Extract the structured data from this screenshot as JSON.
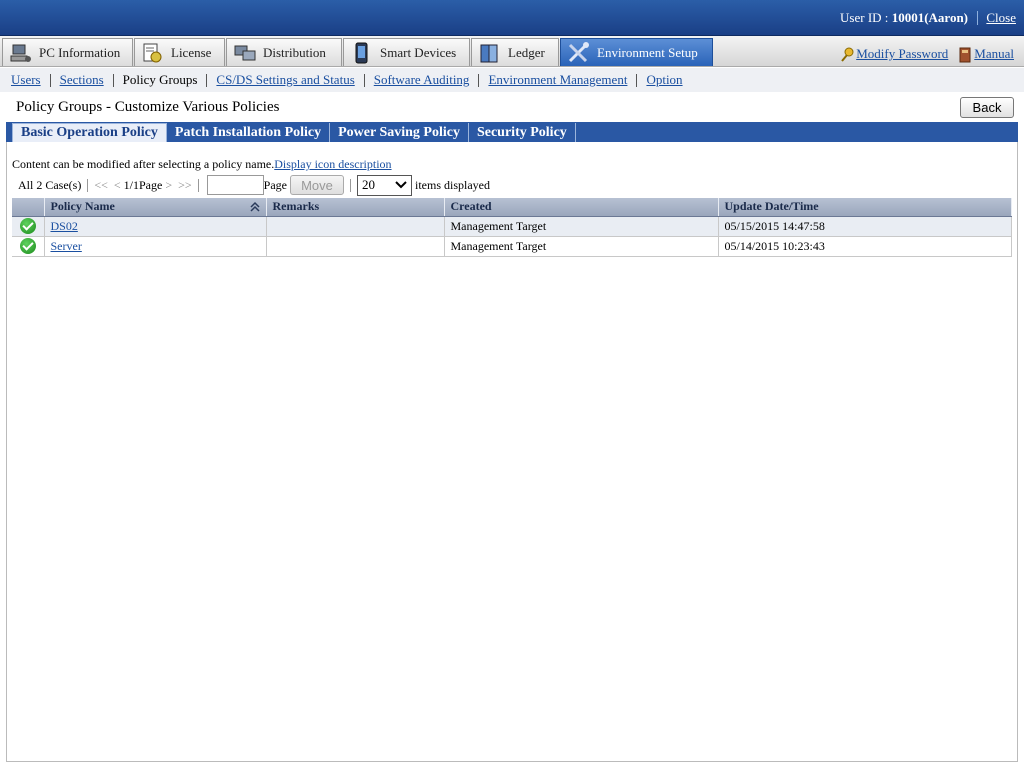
{
  "header": {
    "user_label": "User ID : ",
    "user_value": "10001(Aaron)",
    "close": "Close"
  },
  "mainnav": {
    "tabs": [
      {
        "label": "PC Information",
        "icon": "pc-information-icon"
      },
      {
        "label": "License",
        "icon": "license-icon"
      },
      {
        "label": "Distribution",
        "icon": "distribution-icon"
      },
      {
        "label": "Smart Devices",
        "icon": "smart-devices-icon"
      },
      {
        "label": "Ledger",
        "icon": "ledger-icon"
      },
      {
        "label": "Environment Setup",
        "icon": "environment-setup-icon"
      }
    ],
    "modify_password": "Modify Password",
    "manual": "Manual"
  },
  "subnav": {
    "items": [
      "Users",
      "Sections",
      "Policy Groups",
      "CS/DS Settings and Status",
      "Software Auditing",
      "Environment Management",
      "Option"
    ],
    "current": "Policy Groups"
  },
  "page": {
    "title": "Policy Groups - Customize Various Policies",
    "back": "Back"
  },
  "policy_tabs": [
    "Basic Operation Policy",
    "Patch Installation Policy",
    "Power Saving Policy",
    "Security Policy"
  ],
  "content": {
    "description": "Content can be modified after selecting a policy name.",
    "icon_link": "Display icon description",
    "pager": {
      "total": "All 2 Case(s)",
      "first": "<<",
      "prev": "<",
      "page_info": "1/1Page",
      "next": ">",
      "last": ">>",
      "page_label": "Page",
      "page_input": "",
      "move": "Move",
      "per_page": "20",
      "items_label": "items displayed"
    },
    "table": {
      "columns": [
        "Policy Name",
        "Remarks",
        "Created",
        "Update Date/Time"
      ],
      "rows": [
        {
          "name": "DS02",
          "remarks": "",
          "created": "Management Target",
          "updated": "05/15/2015 14:47:58"
        },
        {
          "name": "Server",
          "remarks": "",
          "created": "Management Target",
          "updated": "05/14/2015 10:23:43"
        }
      ]
    }
  },
  "colors": {
    "header_blue": "#1a3f86",
    "active_tab": "#2a63b8",
    "link": "#1a4fa0",
    "status_ok": "#1b8a1b"
  }
}
